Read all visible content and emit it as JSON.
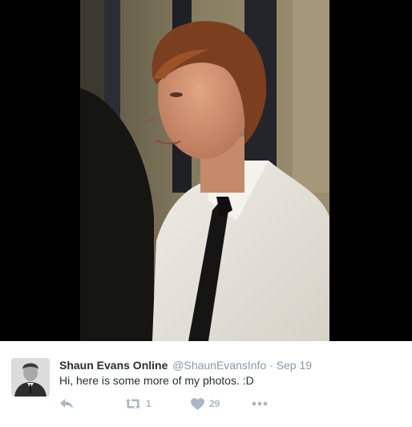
{
  "tweet": {
    "display_name": "Shaun Evans Online",
    "handle": "@ShaunEvansInfo",
    "separator": "·",
    "date": "Sep 19",
    "text": "Hi, here is some more of my photos. :D",
    "actions": {
      "reply_icon": "reply-icon",
      "retweet_icon": "retweet-icon",
      "retweet_count": "1",
      "like_icon": "heart-icon",
      "like_count": "29",
      "more_icon": "more-icon"
    }
  },
  "colors": {
    "name": "#292f33",
    "meta": "#8899a6",
    "action": "#aab8c2"
  }
}
